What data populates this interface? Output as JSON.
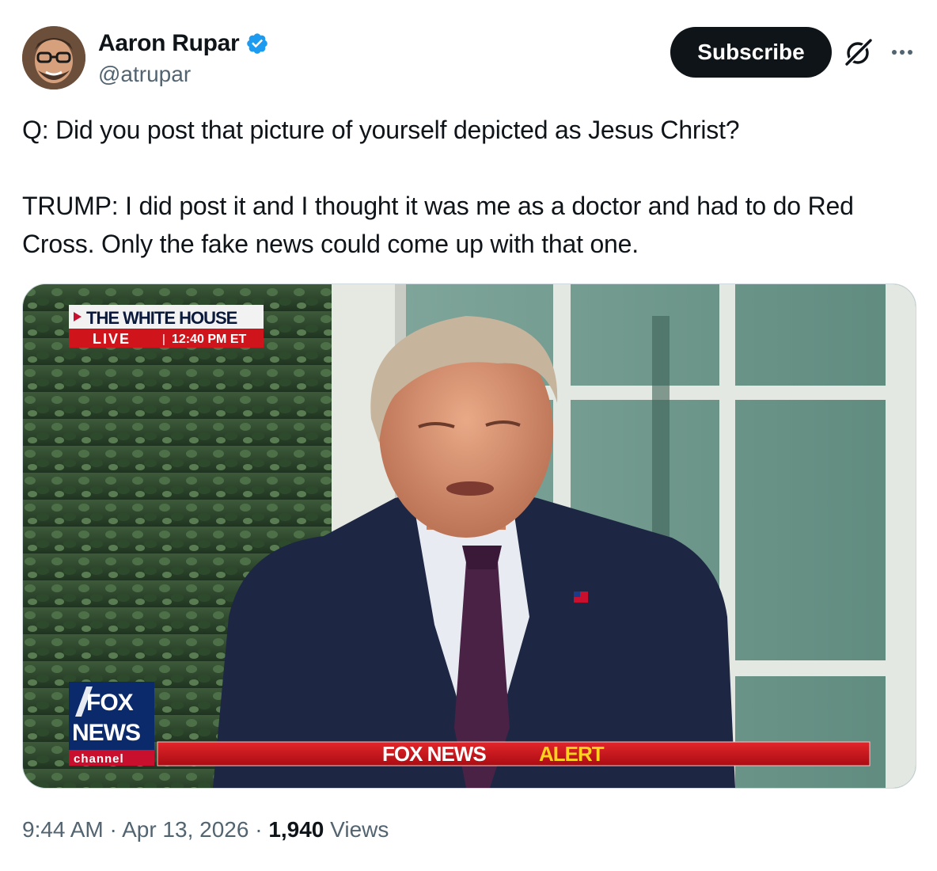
{
  "author": {
    "display_name": "Aaron Rupar",
    "handle": "@atrupar",
    "verified_icon": "verified-badge-icon"
  },
  "header": {
    "subscribe_label": "Subscribe",
    "grok_icon": "grok-icon",
    "more_icon": "more-options-icon"
  },
  "tweet": {
    "paragraph_1": "Q: Did you post that picture of yourself depicted as Jesus Christ?",
    "paragraph_2": "TRUMP: I did post it and I thought it was me as a doctor and had to do Red Cross. Only the fake news could come up with that one."
  },
  "media": {
    "location_label": "THE WHITE HOUSE",
    "live_label": "LIVE",
    "time_label": "12:40 PM ET",
    "logo_line1": "FOX",
    "logo_line2": "NEWS",
    "logo_line3": "channel",
    "alert_prefix": "FOX NEWS",
    "alert_word": "ALERT"
  },
  "meta": {
    "time": "9:44 AM",
    "separator": "·",
    "date": "Apr 13, 2026",
    "views_count": "1,940",
    "views_label": "Views"
  },
  "colors": {
    "text_primary": "#0f1419",
    "text_secondary": "#536471",
    "verified_blue": "#1d9bf0",
    "alert_red": "#d0141c",
    "alert_yellow": "#ffd21f"
  }
}
